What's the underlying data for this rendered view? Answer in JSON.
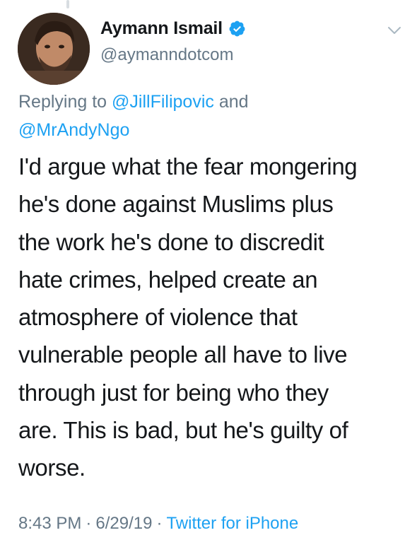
{
  "author": {
    "display_name": "Aymann Ismail",
    "handle": "@aymanndotcom",
    "verified": true,
    "avatar_icon": "profile-avatar"
  },
  "reply": {
    "prefix": "Replying to",
    "mention1": "@JillFilipovic",
    "conjunction": "and",
    "mention2": "@MrAndyNgo"
  },
  "tweet": {
    "lines": [
      "I'd argue what the fear mongering",
      "he's done against Muslims plus",
      "the work he's done to discredit",
      "hate crimes, helped create an",
      "atmosphere of violence that",
      "vulnerable people all have to live",
      "through just for being who they",
      "are. This is bad, but he's guilty of",
      "worse."
    ]
  },
  "meta": {
    "time": "8:43 PM",
    "date": "6/29/19",
    "separator": "·",
    "source": "Twitter for iPhone"
  },
  "colors": {
    "link": "#1da1f2",
    "secondary_text": "#657786",
    "primary_text": "#14171a"
  }
}
